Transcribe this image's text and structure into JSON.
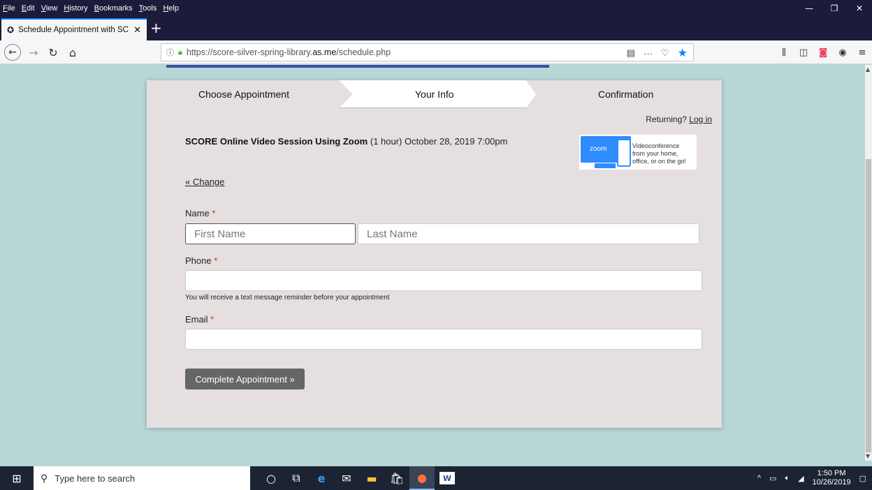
{
  "browser": {
    "menus": [
      "File",
      "Edit",
      "View",
      "History",
      "Bookmarks",
      "Tools",
      "Help"
    ],
    "tab_title": "Schedule Appointment with SC",
    "url_prefix": "https://score-silver-spring-library.",
    "url_domain": "as.me",
    "url_path": "/schedule.php"
  },
  "steps": {
    "step1": "Choose Appointment",
    "step2": "Your Info",
    "step3": "Confirmation"
  },
  "returning": {
    "text": "Returning?",
    "login": "Log in"
  },
  "appointment": {
    "title": "SCORE Online Video Session Using Zoom",
    "details": " (1 hour) October 28, 2019 7:00pm"
  },
  "zoom_badge": {
    "logo": "zoom",
    "line1": "Videoconference",
    "line2": "from your home,",
    "line3": "office, or on the go!"
  },
  "change_link": "« Change",
  "form": {
    "name_label": "Name",
    "first_placeholder": "First Name",
    "last_placeholder": "Last Name",
    "phone_label": "Phone",
    "phone_hint": "You will receive a text message reminder before your appointment",
    "email_label": "Email",
    "required_mark": "*",
    "submit_label": "Complete Appointment »"
  },
  "taskbar": {
    "search_placeholder": "Type here to search",
    "time": "1:50 PM",
    "date": "10/26/2019"
  },
  "colors": {
    "page_bg": "#b8d6d6",
    "card_bg": "#e6dfdf",
    "titlebar": "#1c1b3b",
    "submit_bg": "#666666",
    "required": "#c0392b"
  }
}
